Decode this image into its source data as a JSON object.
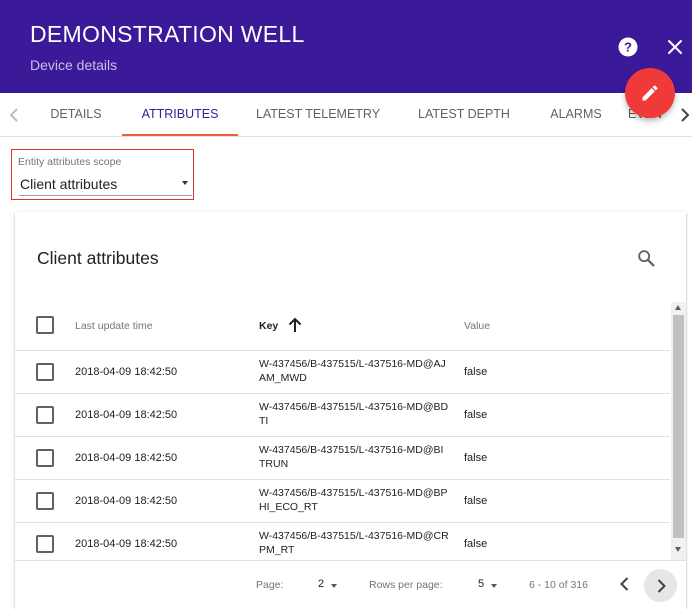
{
  "header": {
    "title": "DEMONSTRATION WELL",
    "subtitle": "Device details"
  },
  "tabs": [
    {
      "label": "DETAILS"
    },
    {
      "label": "ATTRIBUTES"
    },
    {
      "label": "LATEST TELEMETRY"
    },
    {
      "label": "LATEST DEPTH"
    },
    {
      "label": "ALARMS"
    },
    {
      "label": "EVEN"
    }
  ],
  "scope": {
    "label": "Entity attributes scope",
    "value": "Client attributes"
  },
  "card": {
    "title": "Client attributes"
  },
  "table": {
    "columns": {
      "time": "Last update time",
      "key": "Key",
      "value": "Value"
    },
    "rows": [
      {
        "time": "2018-04-09 18:42:50",
        "key": "W-437456/B-437515/L-437516-MD@AJAM_MWD",
        "value": "false"
      },
      {
        "time": "2018-04-09 18:42:50",
        "key": "W-437456/B-437515/L-437516-MD@BDTI",
        "value": "false"
      },
      {
        "time": "2018-04-09 18:42:50",
        "key": "W-437456/B-437515/L-437516-MD@BITRUN",
        "value": "false"
      },
      {
        "time": "2018-04-09 18:42:50",
        "key": "W-437456/B-437515/L-437516-MD@BPHI_ECO_RT",
        "value": "false"
      },
      {
        "time": "2018-04-09 18:42:50",
        "key": "W-437456/B-437515/L-437516-MD@CRPM_RT",
        "value": "false"
      }
    ]
  },
  "pagination": {
    "page_label": "Page:",
    "page_value": "2",
    "rows_label": "Rows per page:",
    "rows_value": "5",
    "range": "6 - 10 of 316"
  },
  "colors": {
    "header_bg": "#3b1a9a",
    "fab": "#f03a3a",
    "tab_ink": "#f05b3a",
    "scope_highlight": "#e03030"
  },
  "icons": [
    "help-icon",
    "close-icon",
    "edit-icon",
    "chevron-left-icon",
    "chevron-right-icon",
    "search-icon",
    "sort-arrow-up-icon"
  ]
}
